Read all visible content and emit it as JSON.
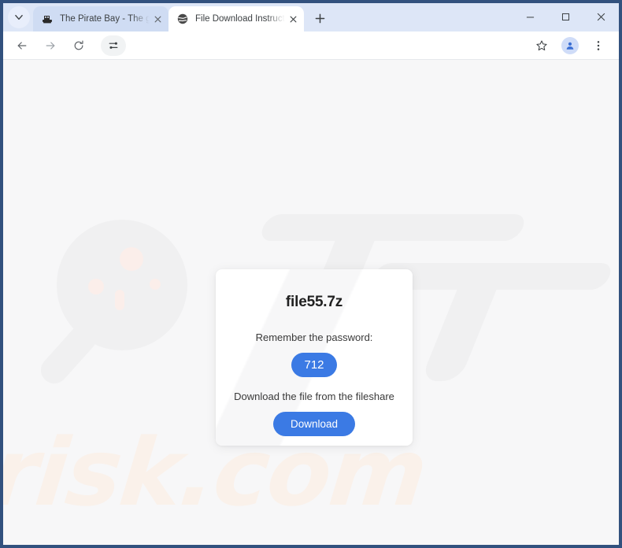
{
  "window": {
    "controls": [
      {
        "name": "minimize",
        "glyph": "minimize-icon"
      },
      {
        "name": "maximize",
        "glyph": "maximize-icon"
      },
      {
        "name": "close",
        "glyph": "close-icon"
      }
    ]
  },
  "tabstrip": {
    "tab_search_label": "Search tabs",
    "new_tab_label": "New Tab",
    "tabs": [
      {
        "title": "The Pirate Bay - The galaxy's m",
        "favicon": "ship-icon",
        "active": false,
        "close_label": "Close"
      },
      {
        "title": "File Download Instructions for ",
        "favicon": "globe-icon",
        "active": true,
        "close_label": "Close"
      }
    ]
  },
  "toolbar": {
    "back_label": "Back",
    "forward_label": "Forward",
    "reload_label": "Reload",
    "tune_label": "Customize Chrome",
    "bookmark_label": "Bookmark this tab",
    "profile_label": "Profile",
    "menu_label": "Customize and control Google Chrome"
  },
  "page": {
    "background_color": "#f7f7f8",
    "watermark_text": "risk.com",
    "card": {
      "filename": "file55.7z",
      "password_prompt": "Remember the password:",
      "password": "712",
      "download_prompt": "Download the file from the fileshare",
      "download_button": "Download",
      "accent_color": "#3b7ae4"
    }
  }
}
